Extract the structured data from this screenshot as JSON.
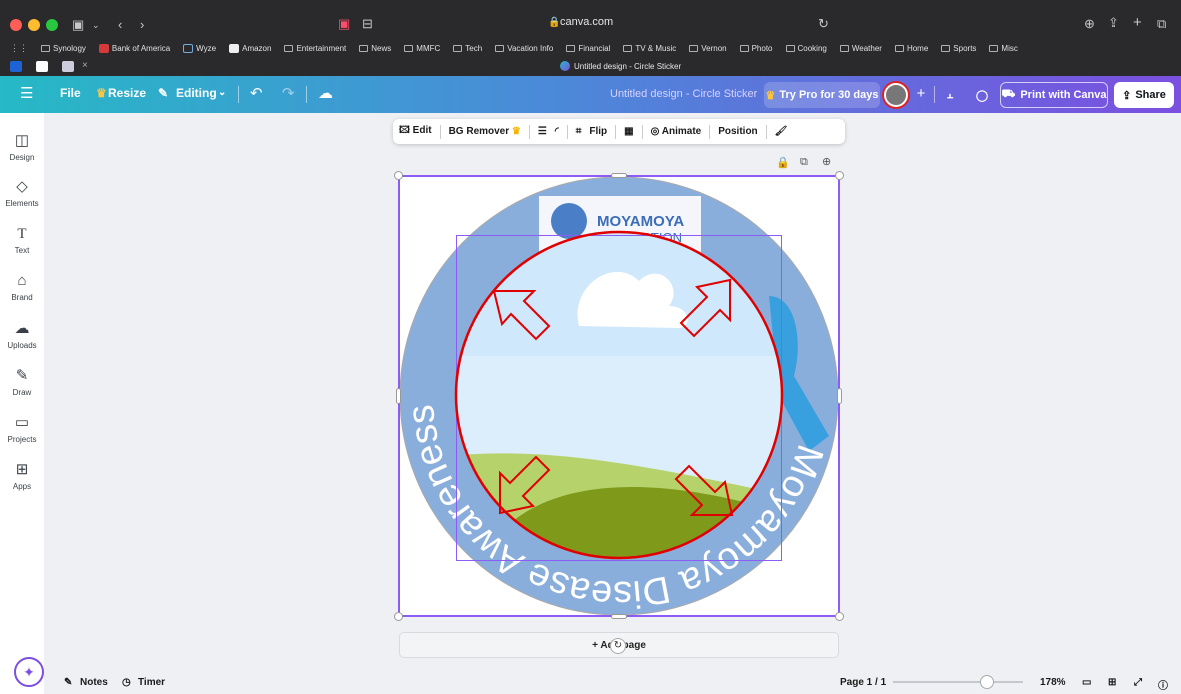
{
  "browser": {
    "address": "canva.com",
    "tab_title": "Untitled design - Circle Sticker",
    "bookmarks": [
      "Synology",
      "Bank of America",
      "Wyze",
      "Amazon",
      "Entertainment",
      "News",
      "MMFC",
      "Tech",
      "Vacation Info",
      "Financial",
      "TV & Music",
      "Vernon",
      "Photo",
      "Cooking",
      "Weather",
      "Home",
      "Sports",
      "Misc"
    ]
  },
  "header": {
    "file": "File",
    "resize": "Resize",
    "editing": "Editing",
    "doc_title": "Untitled design - Circle Sticker",
    "try_pro": "Try Pro for 30 days",
    "print": "Print with Canva",
    "share": "Share"
  },
  "sidebar": [
    {
      "label": "Design",
      "icon": "layout-icon"
    },
    {
      "label": "Elements",
      "icon": "shapes-icon"
    },
    {
      "label": "Text",
      "icon": "text-icon"
    },
    {
      "label": "Brand",
      "icon": "brand-icon"
    },
    {
      "label": "Uploads",
      "icon": "upload-icon"
    },
    {
      "label": "Draw",
      "icon": "pen-icon"
    },
    {
      "label": "Projects",
      "icon": "folder-icon"
    },
    {
      "label": "Apps",
      "icon": "apps-icon"
    }
  ],
  "toolbar": {
    "edit": "Edit",
    "bg_remover": "BG Remover",
    "flip": "Flip",
    "animate": "Animate",
    "position": "Position"
  },
  "sticker": {
    "ring_text": "Moyamoya Disease Awareness",
    "logo_line1": "MOYAMOYA",
    "logo_line2": "FOUNDATION",
    "ring_color": "#8aaedb",
    "accent": "#8b5cf6",
    "arrow_color": "#e00000"
  },
  "add_page": "+ Add page",
  "footer": {
    "notes": "Notes",
    "timer": "Timer",
    "page": "Page 1 / 1",
    "zoom": "178%",
    "zoom_fraction": 0.72
  }
}
